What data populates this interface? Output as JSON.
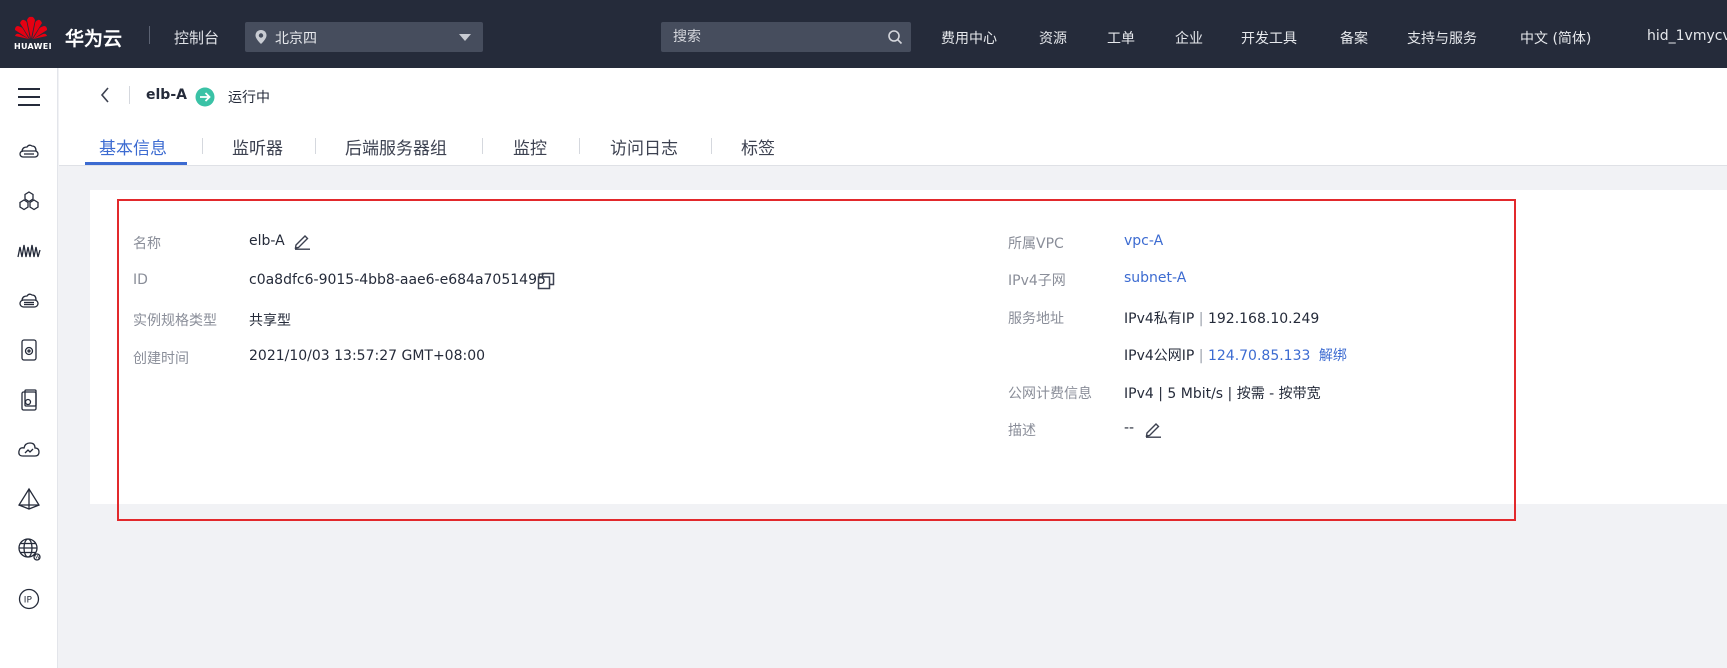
{
  "topbar": {
    "logo_text": "HUAWEI",
    "brand": "华为云",
    "console": "控制台",
    "region": "北京四",
    "search_placeholder": "搜索",
    "nav": [
      "费用中心",
      "资源",
      "工单",
      "企业",
      "开发工具",
      "备案",
      "支持与服务",
      "中文 (简体)",
      "hid_1vmycv"
    ]
  },
  "sidebar": {
    "icons": [
      "menu-icon",
      "cloud-server-icon",
      "cluster-icon",
      "waveform-icon",
      "storage-icon",
      "disk-icon",
      "device-icon",
      "cloud-icon",
      "triangle-icon",
      "globe-icon",
      "ip-icon"
    ]
  },
  "header": {
    "instance_name": "elb-A",
    "status": "运行中",
    "tabs": [
      "基本信息",
      "监听器",
      "后端服务器组",
      "监控",
      "访问日志",
      "标签"
    ],
    "active_tab": "基本信息"
  },
  "details": {
    "left": {
      "name_label": "名称",
      "name_value": "elb-A",
      "id_label": "ID",
      "id_value": "c0a8dfc6-9015-4bb8-aae6-e684a7051495",
      "spec_label": "实例规格类型",
      "spec_value": "共享型",
      "created_label": "创建时间",
      "created_value": "2021/10/03 13:57:27 GMT+08:00"
    },
    "right": {
      "vpc_label": "所属VPC",
      "vpc_value": "vpc-A",
      "subnet_label": "IPv4子网",
      "subnet_value": "subnet-A",
      "addr_label": "服务地址",
      "private_ip_prefix": "IPv4私有IP",
      "pipe": "|",
      "private_ip": "192.168.10.249",
      "public_ip_prefix": "IPv4公网IP",
      "public_ip": "124.70.85.133",
      "unbind": "解绑",
      "billing_label": "公网计费信息",
      "billing_value": "IPv4 | 5 Mbit/s | 按需 - 按带宽",
      "desc_label": "描述",
      "desc_value": "--"
    }
  },
  "colors": {
    "topbar_bg": "#252b3a",
    "accent": "#3c6bd1",
    "status_green": "#3ac2a6",
    "highlight_red": "#e2292c",
    "logo_red": "#e60012"
  }
}
